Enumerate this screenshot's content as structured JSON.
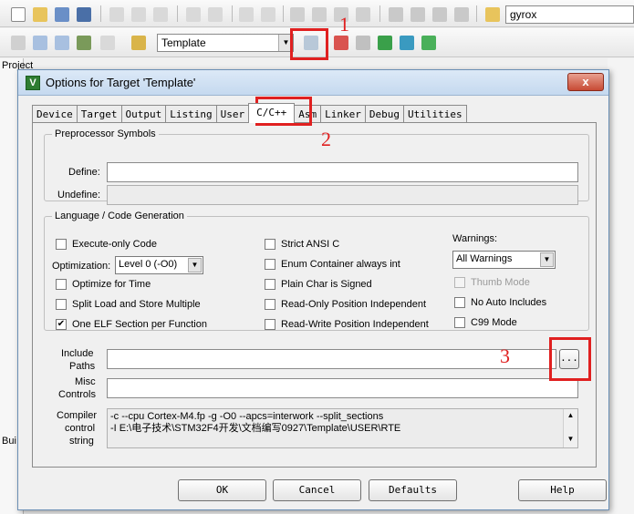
{
  "toolbar": {
    "target_select": "Template",
    "search_field": "gyrox"
  },
  "side": {
    "project_label": "Project",
    "bui_label": "Bui"
  },
  "dialog": {
    "title": "Options for Target 'Template'",
    "close_glyph": "x",
    "tabs": [
      "Device",
      "Target",
      "Output",
      "Listing",
      "User",
      "C/C++",
      "Asm",
      "Linker",
      "Debug",
      "Utilities"
    ],
    "active_tab": "C/C++",
    "preprocessor": {
      "legend": "Preprocessor Symbols",
      "define_label": "Define:",
      "undefine_label": "Undefine:",
      "define_value": "",
      "undefine_value": ""
    },
    "language": {
      "legend": "Language / Code Generation",
      "execute_only": "Execute-only Code",
      "optimization_label": "Optimization:",
      "optimization_value": "Level 0 (-O0)",
      "optimize_time": "Optimize for Time",
      "split_load": "Split Load and Store Multiple",
      "one_elf": "One ELF Section per Function",
      "strict_ansi": "Strict ANSI C",
      "enum_container": "Enum Container always int",
      "plain_char": "Plain Char is Signed",
      "ro_pi": "Read-Only Position Independent",
      "rw_pi": "Read-Write Position Independent",
      "warnings_label": "Warnings:",
      "warnings_value": "All Warnings",
      "thumb_mode": "Thumb Mode",
      "no_auto_includes": "No Auto Includes",
      "c99_mode": "C99 Mode",
      "check_mark": "✔"
    },
    "include_label_1": "Include",
    "include_label_2": "Paths",
    "include_browse": "...",
    "misc_label_1": "Misc",
    "misc_label_2": "Controls",
    "compiler_label_1": "Compiler",
    "compiler_label_2": "control",
    "compiler_label_3": "string",
    "compiler_line_1": "-c --cpu Cortex-M4.fp -g -O0 --apcs=interwork --split_sections",
    "compiler_line_2": "-I E:\\电子技术\\STM32F4开发\\文档编写0927\\Template\\USER\\RTE",
    "buttons": {
      "ok": "OK",
      "cancel": "Cancel",
      "defaults": "Defaults",
      "help": "Help"
    }
  },
  "annotations": [
    "1",
    "2",
    "3"
  ],
  "colors": {
    "annotation_red": "#e02020",
    "title_bar": "#c5d9ef"
  }
}
